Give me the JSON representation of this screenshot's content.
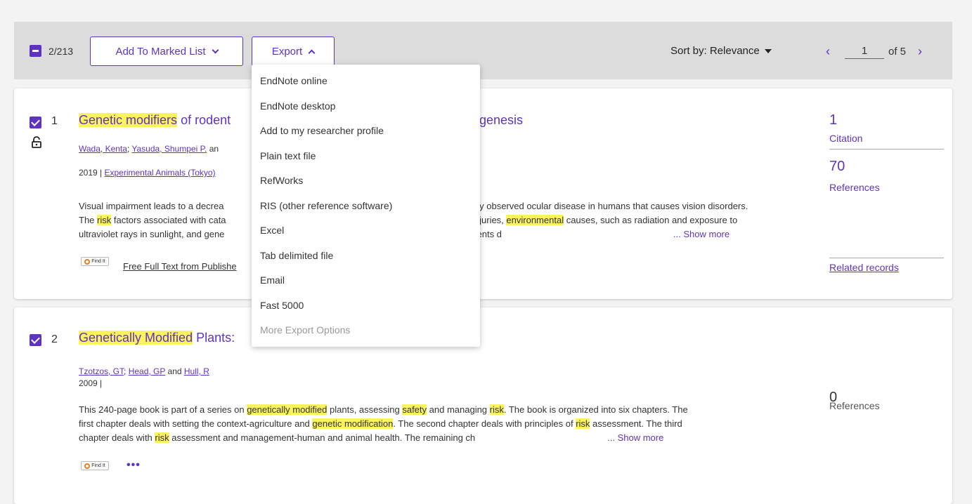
{
  "toolbar": {
    "selected_count": "2/213",
    "add_to_marked_list": "Add To Marked List",
    "export": "Export",
    "sort_by": "Sort by: Relevance",
    "page_current": "1",
    "page_of": "of 5",
    "prev": "‹",
    "next": "›"
  },
  "export_menu": {
    "items": [
      "EndNote online",
      "EndNote desktop",
      "Add to my researcher profile",
      "Plain text file",
      "RefWorks",
      "RIS (other reference software)",
      "Excel",
      "Tab delimited file",
      "Email",
      "Fast 5000",
      "More Export Options"
    ]
  },
  "records": [
    {
      "number": "1",
      "title_hl": "Genetic modifiers",
      "title_rest": " of rodent",
      "title_tail": "genesis",
      "author1": "Wada, Kenta",
      "author2": "Yasuda, Shumpei P.",
      "author_tail": "an",
      "year": "2019 |",
      "journal": "Experimental Animals (Tokyo)",
      "abstract_l1_a": "Visual impairment leads to a decrea",
      "abstract_l1_b": "nly observed ocular disease in humans that causes vision disorders.",
      "abstract_l2_a": "The ",
      "abstract_l2_hl": "risk",
      "abstract_l2_b": " factors associated with cata",
      "abstract_l2_c": "injuries, ",
      "abstract_l2_hl2": "environmental",
      "abstract_l2_d": " causes, such as radiation and exposure to",
      "abstract_l3_a": "ultraviolet rays in sunlight, and gene",
      "abstract_l3_b": "tients d",
      "show_more": "... Show more",
      "findit": "Find It",
      "free_full_text": "Free Full Text from Publishe",
      "citations": "1",
      "citations_label": "Citation",
      "references": "70",
      "references_label": "References",
      "related": "Related records"
    },
    {
      "number": "2",
      "title_hl": "Genetically Modified",
      "title_rest": " Plants:",
      "author1": "Tzotzos, GT",
      "author2": "Head, GP",
      "author_and": "and",
      "author3": "Hull, R",
      "year": "2009 |",
      "abstract": {
        "p1": "This 240-page book is part of a series on ",
        "h1": "genetically modified",
        "p2": " plants, assessing ",
        "h2": "safety",
        "p3": " and managing ",
        "h3": "risk",
        "p4": ". The book is organized into six chapters. The",
        "p5": "first chapter deals with setting the context-agriculture and ",
        "h4": "genetic modification",
        "p6": ". The second chapter deals with principles of ",
        "h5": "risk",
        "p7": " assessment. The third",
        "p8": "chapter deals with ",
        "h6": "risk",
        "p9": " assessment and management-human and animal health. The remaining ch"
      },
      "show_more": "... Show more",
      "findit": "Find It",
      "more_dots": "•••",
      "references": "0",
      "references_label": "References"
    }
  ]
}
